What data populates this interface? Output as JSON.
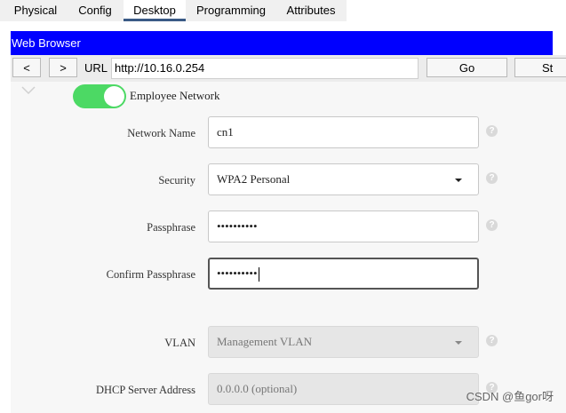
{
  "tabs": [
    {
      "label": "Physical"
    },
    {
      "label": "Config"
    },
    {
      "label": "Desktop"
    },
    {
      "label": "Programming"
    },
    {
      "label": "Attributes"
    }
  ],
  "browser": {
    "title": "Web Browser",
    "back_label": "<",
    "forward_label": ">",
    "url_label": "URL",
    "url_value": "http://10.16.0.254",
    "go_label": "Go",
    "stop_label": "St"
  },
  "form": {
    "toggle_label": "Employee Network",
    "toggle_on": true,
    "network_name_label": "Network Name",
    "network_name_value": "cn1",
    "security_label": "Security",
    "security_value": "WPA2 Personal",
    "passphrase_label": "Passphrase",
    "passphrase_value": "••••••••••",
    "confirm_label": "Confirm Passphrase",
    "confirm_value": "••••••••••",
    "vlan_label": "VLAN",
    "vlan_value": "Management VLAN",
    "dhcp_label": "DHCP Server Address",
    "dhcp_placeholder": "0.0.0.0 (optional)",
    "help_glyph": "?"
  },
  "watermark": "CSDN @鱼gor呀",
  "colors": {
    "title_bar": "#0000ff",
    "toggle_on": "#4cd964",
    "active_tab_underline": "#3a5a86"
  }
}
